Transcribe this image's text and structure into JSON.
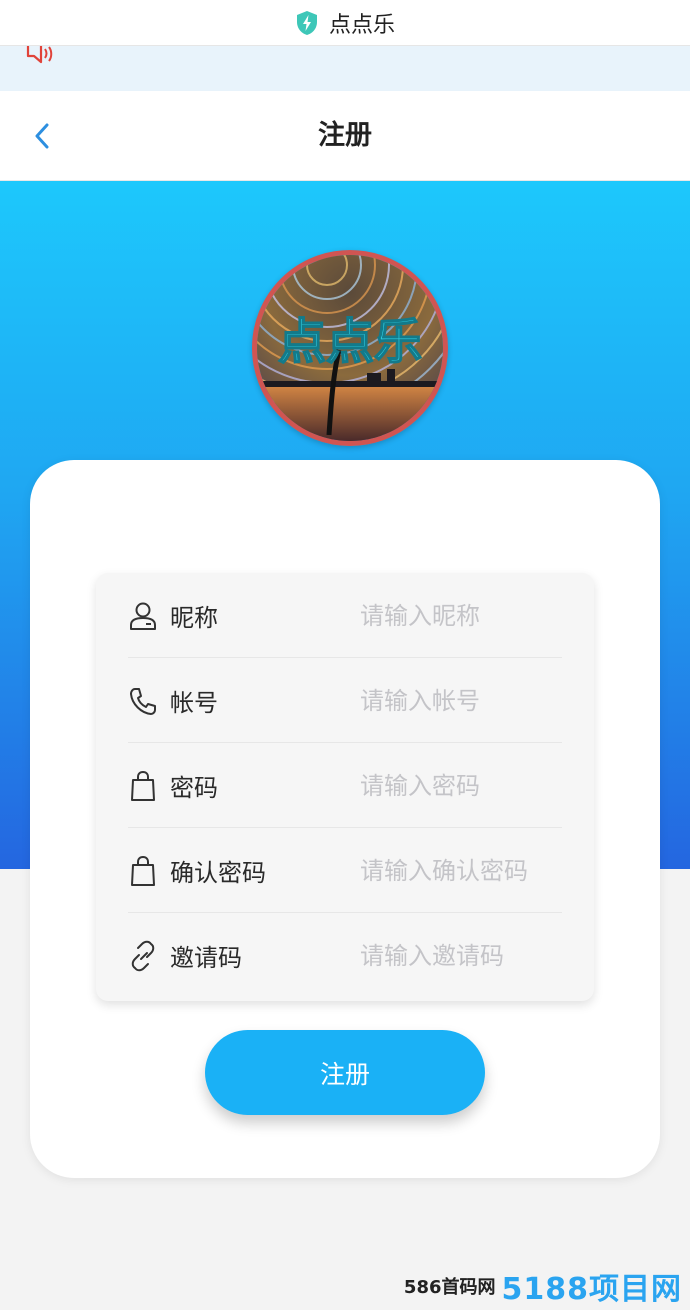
{
  "app_bar": {
    "app_name": "点点乐",
    "icon": "shield-bolt-icon",
    "icon_color": "#3ec7b8"
  },
  "notice_bar": {
    "icon": "speaker-icon",
    "icon_color": "#e0433a"
  },
  "nav": {
    "title": "注册",
    "back_icon": "chevron-left-icon",
    "back_color": "#2d8fe0"
  },
  "logo": {
    "text": "点点乐",
    "text_color": "#2fd0e6",
    "border_color": "#d05552"
  },
  "colors": {
    "hero_top": "#1dc8fc",
    "hero_bottom": "#2466e0",
    "button": "#1ab1f6"
  },
  "form": {
    "fields": [
      {
        "icon": "user-icon",
        "label": "昵称",
        "placeholder": "请输入昵称",
        "value": ""
      },
      {
        "icon": "phone-icon",
        "label": "帐号",
        "placeholder": "请输入帐号",
        "value": ""
      },
      {
        "icon": "bag-icon",
        "label": "密码",
        "placeholder": "请输入密码",
        "value": ""
      },
      {
        "icon": "bag-icon",
        "label": "确认密码",
        "placeholder": "请输入确认密码",
        "value": ""
      },
      {
        "icon": "link-icon",
        "label": "邀请码",
        "placeholder": "请输入邀请码",
        "value": ""
      }
    ]
  },
  "submit_label": "注册",
  "watermark": {
    "site": "586首码网",
    "logo": "5188项目网"
  }
}
